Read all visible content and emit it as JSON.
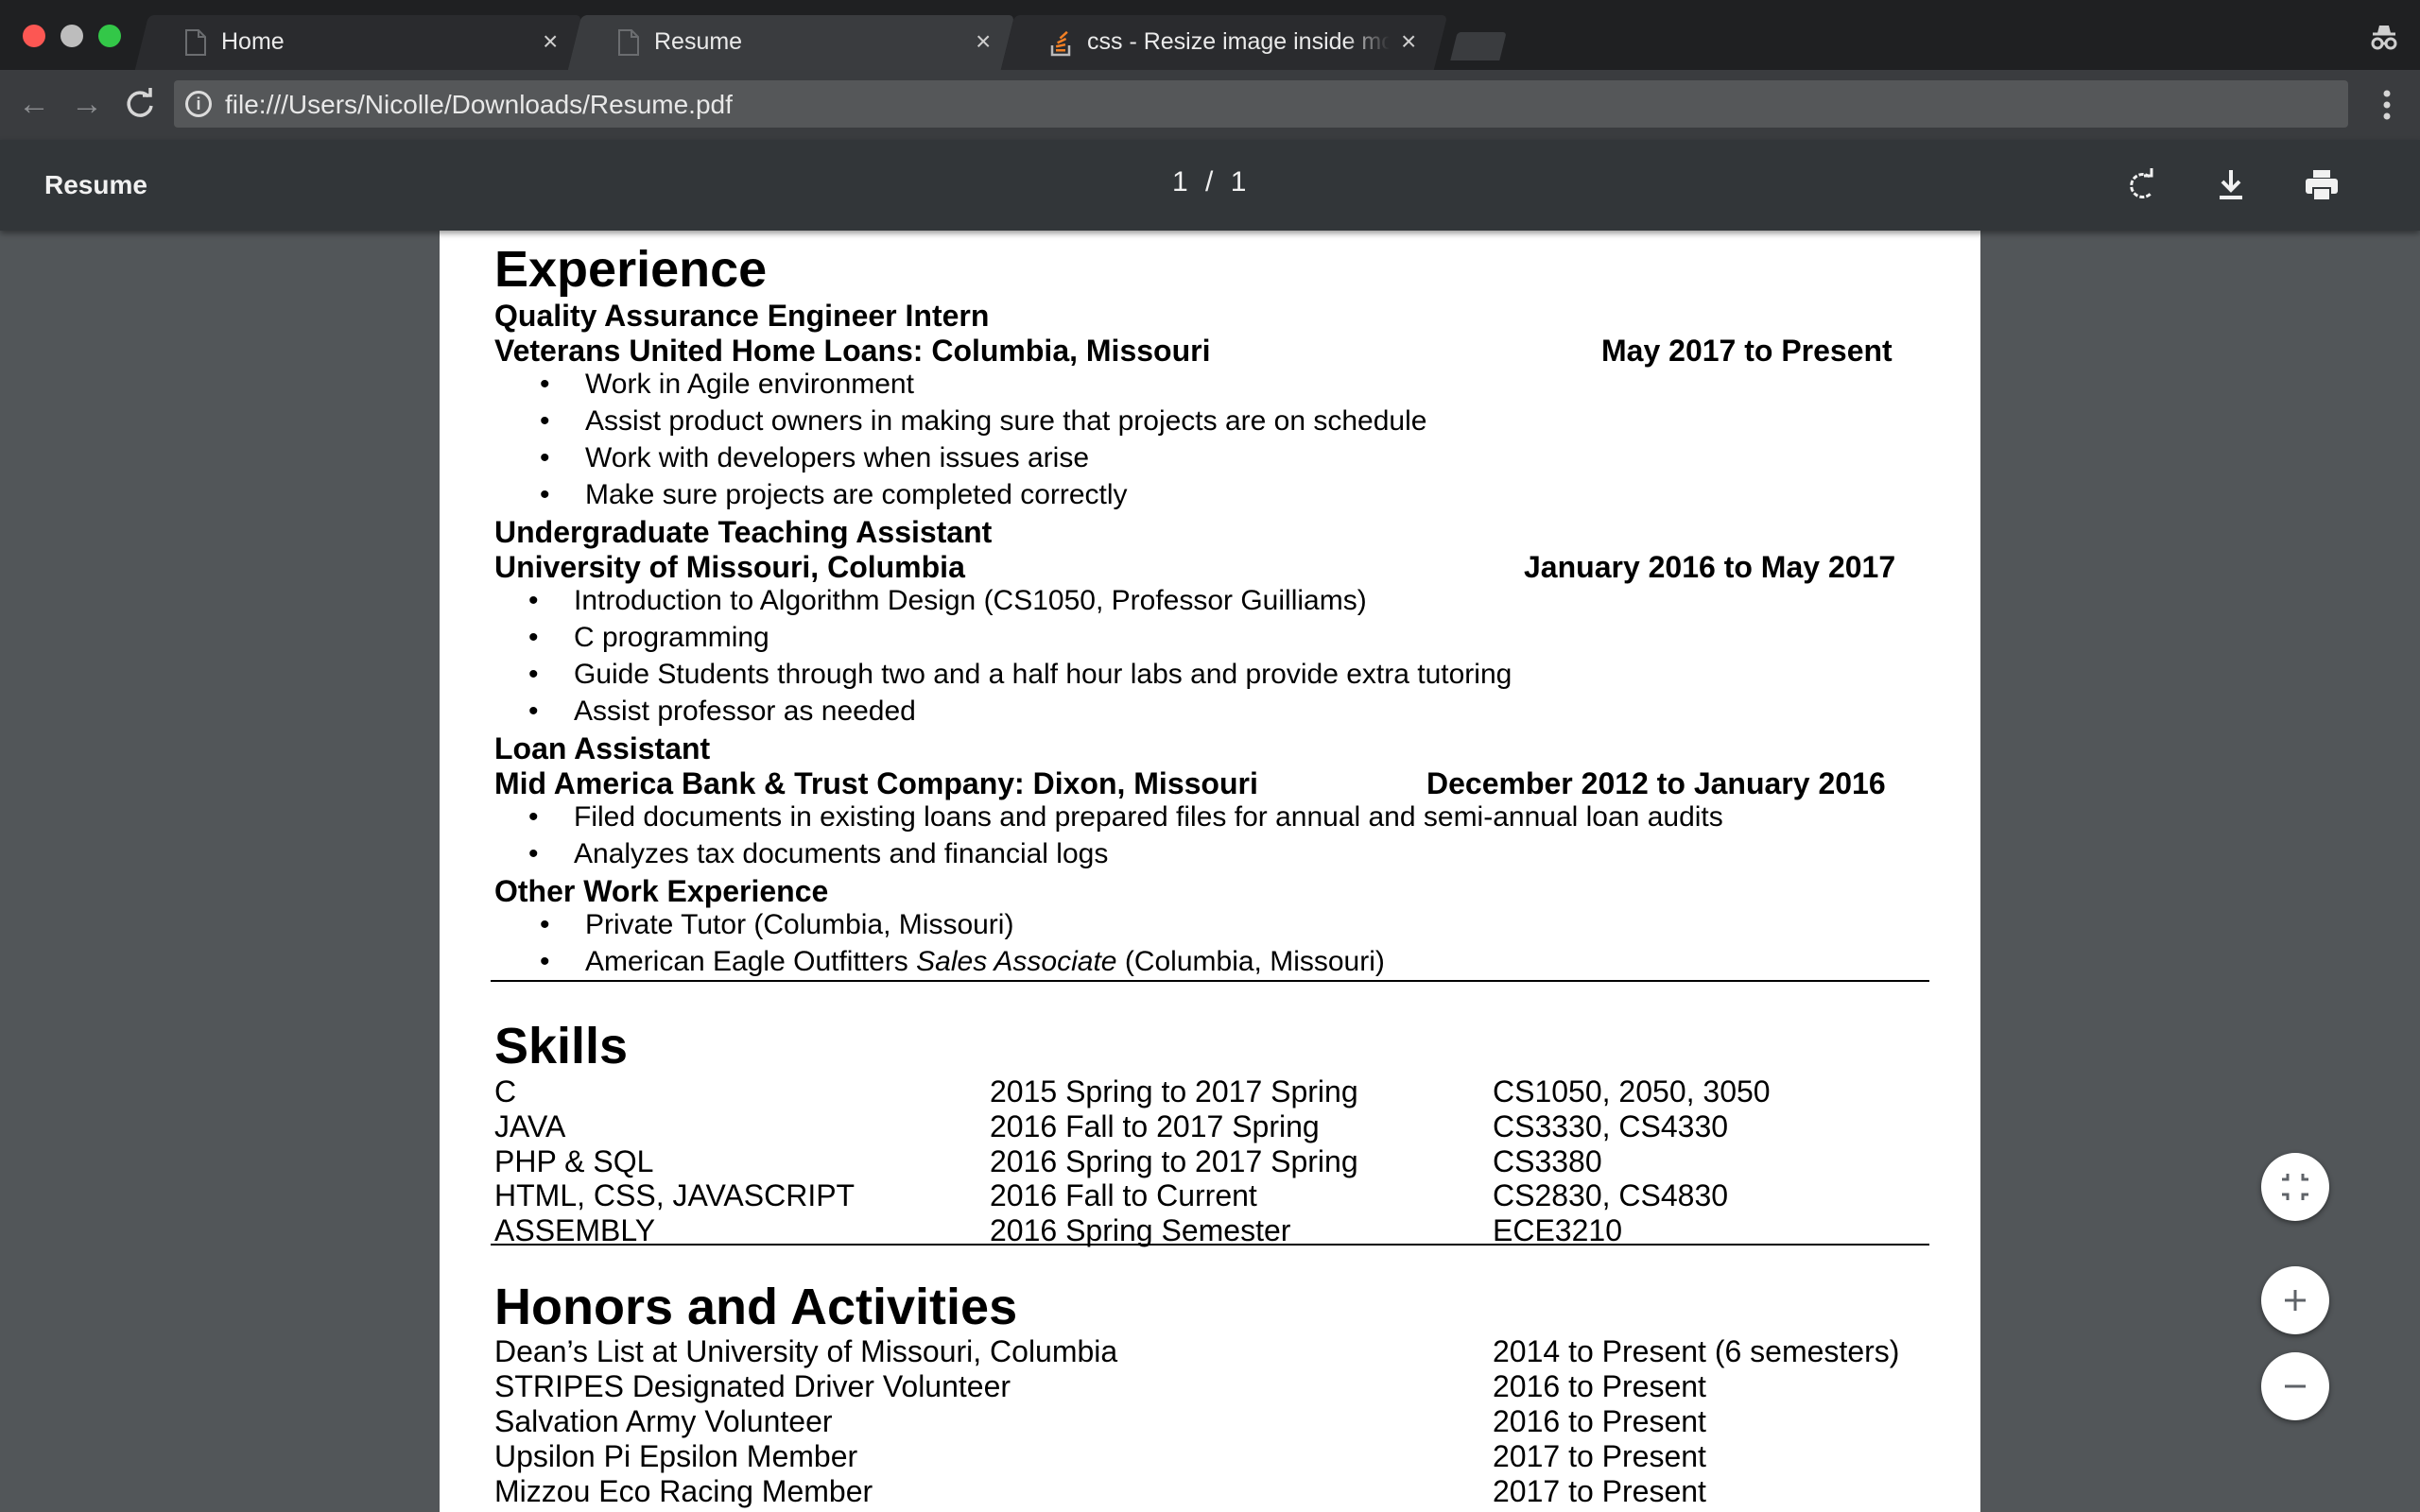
{
  "window": {
    "tabs": [
      {
        "title": "Home",
        "active": false,
        "favicon": "page-icon"
      },
      {
        "title": "Resume",
        "active": true,
        "favicon": "page-icon"
      },
      {
        "title": "css - Resize image inside mod",
        "active": false,
        "favicon": "stackoverflow-icon"
      }
    ],
    "incognito_icon": "incognito-icon"
  },
  "toolbar": {
    "url": "file:///Users/Nicolle/Downloads/Resume.pdf",
    "icons": [
      "back-icon",
      "forward-icon",
      "reload-icon",
      "info-icon",
      "star-icon",
      "menu-icon"
    ]
  },
  "pdf_viewer": {
    "title": "Resume",
    "page_current": "1",
    "page_separator": "/",
    "page_total": "1",
    "icons": [
      "rotate-icon",
      "download-icon",
      "print-icon",
      "fit-page-icon",
      "zoom-in-icon",
      "zoom-out-icon"
    ]
  },
  "resume": {
    "experience": {
      "heading": "Experience",
      "jobs": [
        {
          "title": "Quality Assurance Engineer Intern",
          "employer": "Veterans United Home Loans: Columbia, Missouri",
          "dates": "May 2017 to Present",
          "bullets": [
            "Work in Agile environment",
            "Assist product owners in making sure that projects are on schedule",
            "Work with developers when issues arise",
            "Make sure projects are completed correctly"
          ]
        },
        {
          "title": "Undergraduate Teaching Assistant",
          "employer": "University of Missouri, Columbia",
          "dates": "January 2016 to May 2017",
          "bullets": [
            "Introduction to Algorithm Design (CS1050, Professor Guilliams)",
            "C programming",
            "Guide Students through two and a half hour labs and provide extra tutoring",
            "Assist professor as needed"
          ]
        },
        {
          "title": "Loan Assistant",
          "employer": "Mid America Bank & Trust Company: Dixon, Missouri",
          "dates": "December 2012 to January 2016",
          "bullets": [
            "Filed documents in existing loans and prepared files for annual and semi-annual loan audits",
            "Analyzes tax documents and financial logs"
          ]
        }
      ],
      "other": {
        "title": "Other Work Experience",
        "bullets": [
          "Private Tutor (Columbia, Missouri)"
        ],
        "last": {
          "pre": "American Eagle Outfitters ",
          "italic": "Sales Associate",
          "post": " (Columbia, Missouri)"
        }
      }
    },
    "skills": {
      "heading": "Skills",
      "rows": [
        [
          "C",
          "2015 Spring to 2017 Spring",
          "CS1050, 2050, 3050"
        ],
        [
          "JAVA",
          "2016 Fall to 2017 Spring",
          "CS3330, CS4330"
        ],
        [
          "PHP & SQL",
          "2016 Spring to 2017 Spring",
          "CS3380"
        ],
        [
          "HTML, CSS, JAVASCRIPT",
          "2016 Fall to Current",
          "CS2830, CS4830"
        ],
        [
          "ASSEMBLY",
          "2016 Spring Semester",
          "ECE3210"
        ]
      ]
    },
    "honors": {
      "heading": "Honors and Activities",
      "rows": [
        [
          "Dean’s List at University of Missouri, Columbia",
          "2014 to Present (6 semesters)"
        ],
        [
          "STRIPES Designated Driver Volunteer",
          "2016 to Present"
        ],
        [
          "Salvation Army Volunteer",
          "2016 to Present"
        ],
        [
          "Upsilon Pi Epsilon Member",
          "2017 to Present"
        ],
        [
          "Mizzou Eco Racing Member",
          "2017 to Present"
        ]
      ]
    }
  }
}
